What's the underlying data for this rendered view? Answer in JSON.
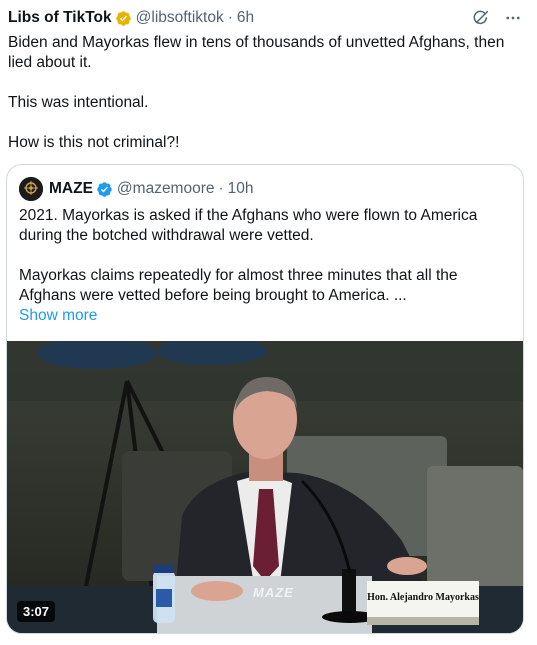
{
  "post": {
    "author_name": "Libs of TikTok",
    "handle": "@libsoftiktok",
    "separator": "·",
    "time": "6h",
    "lines": [
      "Biden and Mayorkas flew in tens of thousands of unvetted Afghans, then lied about it.",
      "This was intentional.",
      "How is this not criminal?!"
    ]
  },
  "quote": {
    "author_name": "MAZE",
    "handle": "@mazemoore",
    "separator": "·",
    "time": "10h",
    "paragraphs": [
      "2021. Mayorkas is asked if the Afghans who were flown to America during the botched withdrawal were vetted.",
      "Mayorkas claims repeatedly for almost three minutes that all the Afghans were vetted before being brought to America. ..."
    ],
    "show_more": "Show more",
    "video": {
      "duration": "3:07",
      "nameplate": "Hon. Alejandro Mayorkas",
      "watermark": "MAZE"
    }
  },
  "colors": {
    "text": "#0f1419",
    "secondary": "#536471",
    "link": "#1d9bf0",
    "verified_gold": "#e8b200",
    "verified_blue": "#1d9bf0",
    "border": "#cfd9de"
  },
  "icons": {
    "grok": "grok-icon",
    "more": "more-icon",
    "verified_gold": "verified-gold-badge-icon",
    "verified_blue": "verified-blue-badge-icon"
  }
}
